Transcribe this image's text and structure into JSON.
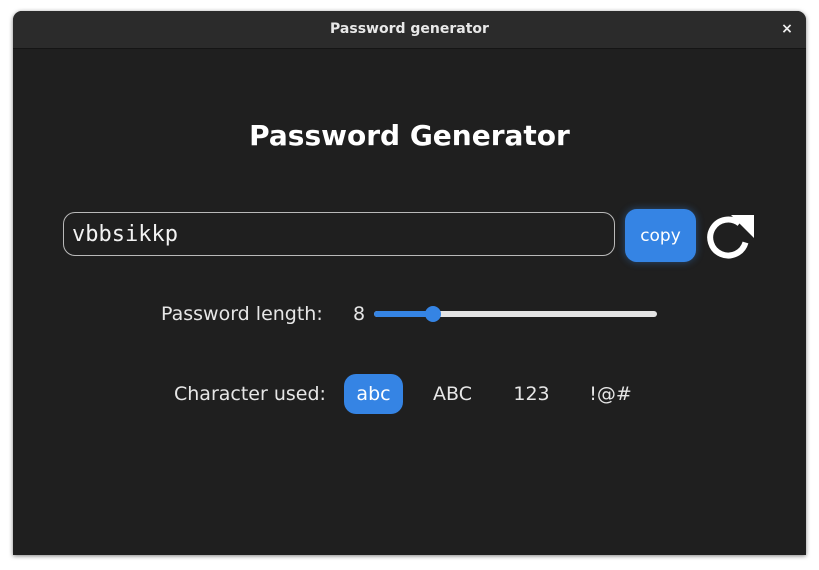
{
  "window": {
    "title": "Password generator",
    "close_glyph": "×"
  },
  "main": {
    "heading": "Password Generator",
    "password_value": "vbbsikkp",
    "copy_label": "copy",
    "refresh_icon": "refresh-icon"
  },
  "length": {
    "label": "Password length:",
    "value": "8",
    "slider_fraction": 0.21
  },
  "characters": {
    "label": "Character used:",
    "options": [
      {
        "label": "abc",
        "active": true
      },
      {
        "label": "ABC",
        "active": false
      },
      {
        "label": "123",
        "active": false
      },
      {
        "label": "!@#",
        "active": false
      }
    ]
  },
  "colors": {
    "accent": "#3584e4",
    "background": "#1f1f1f",
    "titlebar": "#2b2b2b"
  }
}
